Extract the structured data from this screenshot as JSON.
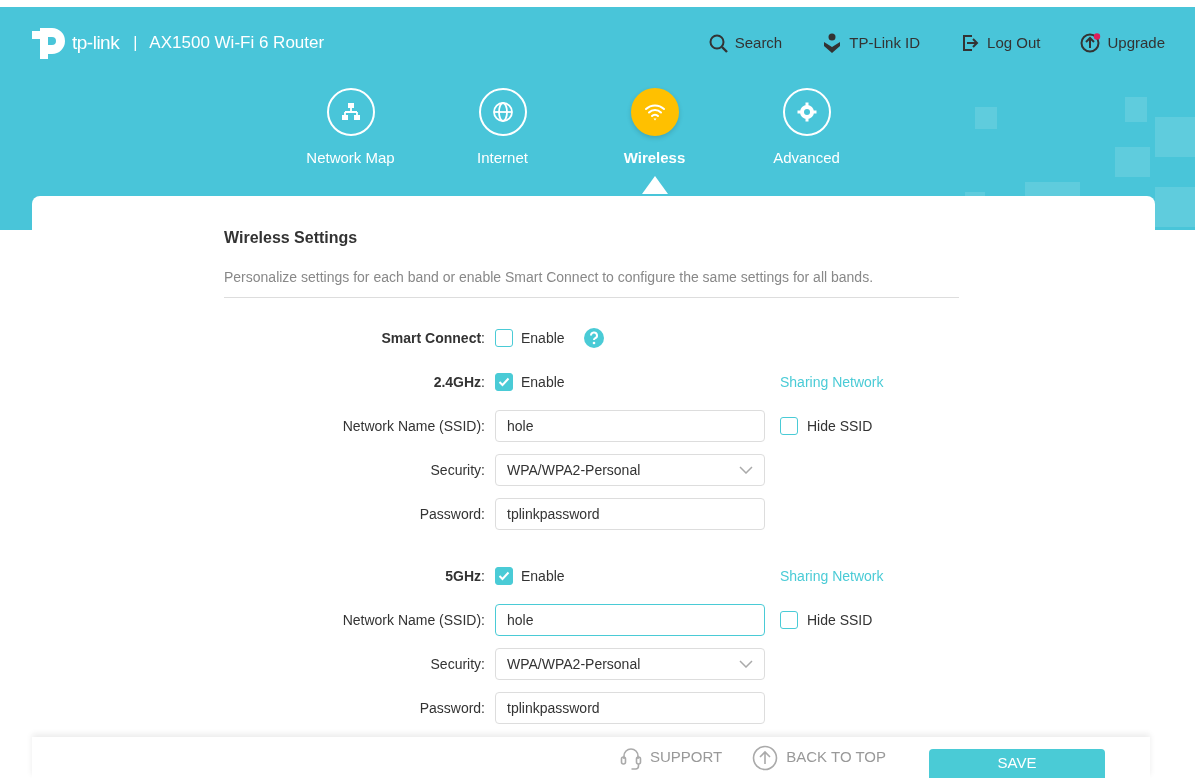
{
  "header": {
    "logo_text": "tp-link",
    "separator": "|",
    "product": "AX1500 Wi-Fi 6 Router",
    "links": [
      {
        "label": "Search",
        "kind": "search",
        "notification": false
      },
      {
        "label": "TP-Link ID",
        "kind": "id",
        "notification": false
      },
      {
        "label": "Log Out",
        "kind": "logout",
        "notification": false
      },
      {
        "label": "Upgrade",
        "kind": "upgrade",
        "notification": true
      }
    ]
  },
  "nav": [
    {
      "label": "Network Map",
      "kind": "map",
      "selected": false
    },
    {
      "label": "Internet",
      "kind": "globe",
      "selected": false
    },
    {
      "label": "Wireless",
      "kind": "wifi",
      "selected": true
    },
    {
      "label": "Advanced",
      "kind": "gear",
      "selected": false
    }
  ],
  "section": {
    "title": "Wireless Settings",
    "description": "Personalize settings for each band or enable Smart Connect to configure the same settings for all bands."
  },
  "smart_connect": {
    "label": "**Smart Connect**:",
    "option": "Enable",
    "checked": false
  },
  "bands": [
    {
      "label": "**2.4GHz**:",
      "option": "Enable",
      "checked": true,
      "link": "Sharing Network",
      "ssid_label": "Network Name (SSID):",
      "ssid": "hole",
      "ssid_focused": false,
      "hide_label": "Hide SSID",
      "hide_checked": false,
      "security_label": "Security:",
      "security": "WPA/WPA2-Personal",
      "password_label": "Password:",
      "password": "tplinkpassword"
    },
    {
      "label": "**5GHz**:",
      "option": "Enable",
      "checked": true,
      "link": "Sharing Network",
      "ssid_label": "Network Name (SSID):",
      "ssid": "hole",
      "ssid_focused": true,
      "hide_label": "Hide SSID",
      "hide_checked": false,
      "security_label": "Security:",
      "security": "WPA/WPA2-Personal",
      "password_label": "Password:",
      "password": "tplinkpassword"
    }
  ],
  "footer": {
    "support": "SUPPORT",
    "back_to_top": "BACK TO TOP",
    "save": "SAVE"
  }
}
